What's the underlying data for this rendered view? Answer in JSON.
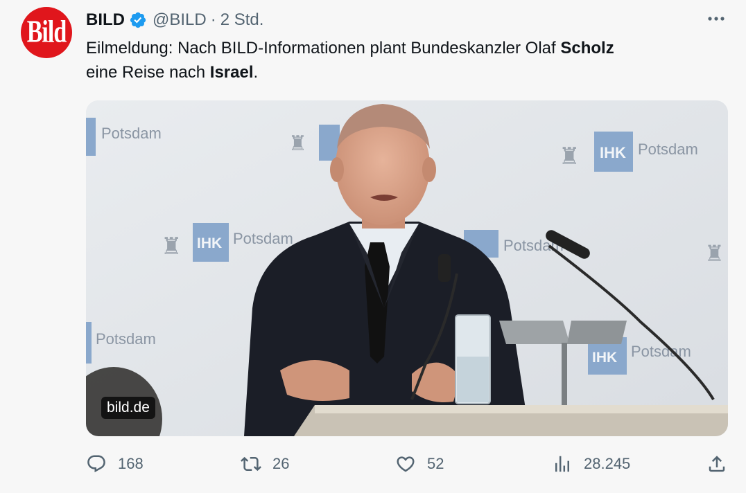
{
  "account": {
    "avatar_text": "Bild",
    "name": "BILD",
    "handle": "@BILD",
    "separator": "·",
    "time": "2 Std.",
    "verified_color": "#1d9bf0",
    "brand_color": "#e0161c"
  },
  "tweet": {
    "text_1": "Eilmeldung: Nach BILD-Informationen plant Bundeskanzler Olaf ",
    "bold_1": "Scholz",
    "text_2": "eine Reise nach ",
    "bold_2": "Israel",
    "text_3": "."
  },
  "media": {
    "source": "bild.de",
    "backdrop_text": {
      "potsdam": "Potsdam",
      "ihk": "IHK"
    }
  },
  "actions": {
    "replies": "168",
    "reposts": "26",
    "likes": "52",
    "views": "28.245"
  },
  "icons": {
    "more": "more-icon",
    "reply": "reply-icon",
    "repost": "repost-icon",
    "like": "like-icon",
    "views": "views-icon",
    "share": "share-icon"
  }
}
